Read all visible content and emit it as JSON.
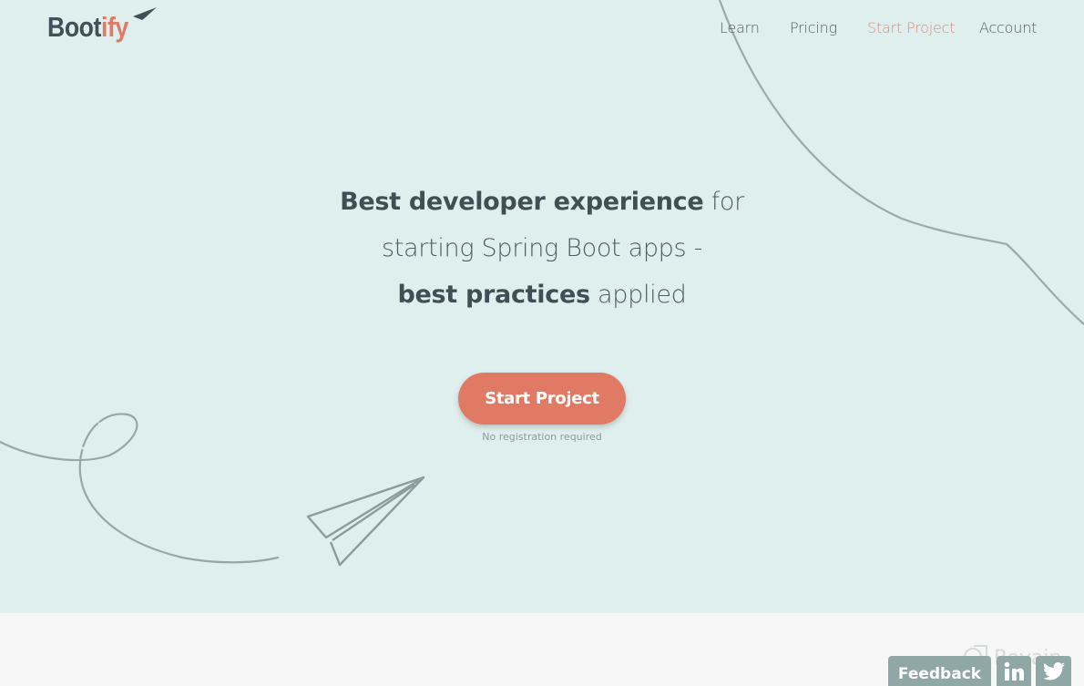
{
  "brand": {
    "name_part1": "Boot",
    "name_part2": "ify",
    "logo_icon": "paper-plane-icon",
    "colors": {
      "dark": "#3f5058",
      "accent": "#e07a65"
    }
  },
  "nav": {
    "items": [
      {
        "label": "Learn",
        "active": false
      },
      {
        "label": "Pricing",
        "active": false
      },
      {
        "label": "Start Project",
        "active": true
      },
      {
        "label": "Account",
        "active": false
      }
    ]
  },
  "hero": {
    "line1_bold": "Best developer experience",
    "line1_light": " for",
    "line2_light": "starting Spring Boot apps -",
    "line3_bold": "best practices",
    "line3_light": " applied",
    "cta_label": "Start Project",
    "cta_note": "No registration required",
    "background": "#dfefee"
  },
  "footer_buttons": {
    "feedback_label": "Feedback",
    "linkedin_icon": "linkedin-icon",
    "twitter_icon": "twitter-icon"
  },
  "watermark": {
    "text": "Revain"
  }
}
